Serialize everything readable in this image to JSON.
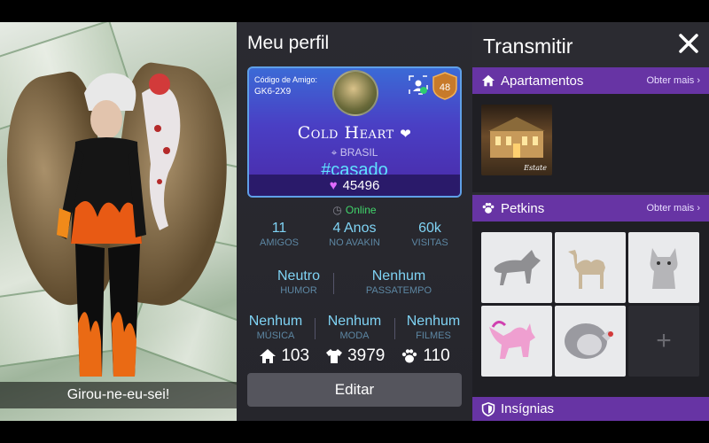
{
  "avatar": {
    "caption": "Girou-ne-eu-sei!"
  },
  "profile": {
    "title": "Meu perfil",
    "friend_code_label": "Código de Amigo:",
    "friend_code": "GK6-2X9",
    "level": "48",
    "name": "Cold Heart",
    "location": "BRASIL",
    "status_tag": "#casado",
    "gems": "45496",
    "online": "Online",
    "stats": [
      {
        "value": "11",
        "label": "AMIGOS"
      },
      {
        "value": "4 Anos",
        "label": "NO AVAKIN"
      },
      {
        "value": "60k",
        "label": "VISITAS"
      }
    ],
    "mood": {
      "value": "Neutro",
      "label": "HUMOR"
    },
    "hobby": {
      "value": "Nenhum",
      "label": "PASSATEMPO"
    },
    "prefs": [
      {
        "value": "Nenhum",
        "label": "MÚSICA"
      },
      {
        "value": "Nenhum",
        "label": "MODA"
      },
      {
        "value": "Nenhum",
        "label": "FILMES"
      }
    ],
    "counts": {
      "homes": "103",
      "outfits": "3979",
      "pets": "110"
    },
    "edit_label": "Editar"
  },
  "transmit": {
    "title": "Transmitir",
    "apartments": {
      "label": "Apartamentos",
      "more": "Obter mais",
      "thumb_label": "Estate"
    },
    "petkins": {
      "label": "Petkins",
      "more": "Obter mais",
      "items": [
        "wolf",
        "camel",
        "bulldog",
        "unicorn",
        "turkey"
      ]
    },
    "badges": {
      "label": "Insígnias"
    }
  },
  "colors": {
    "accent_purple": "#6734a4",
    "online_green": "#41d66b",
    "tag_cyan": "#5fe1ff",
    "stat_blue": "#7fd3f4"
  }
}
